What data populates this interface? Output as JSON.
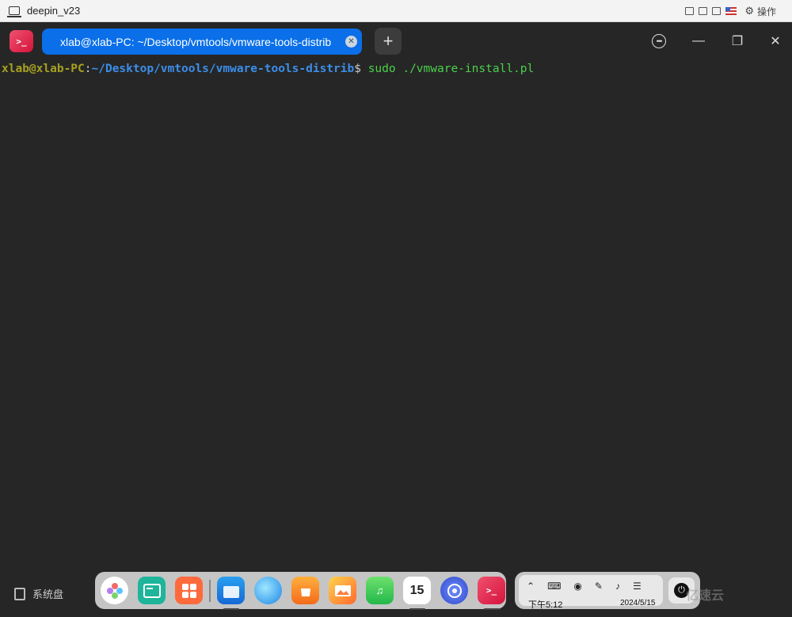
{
  "vm_window": {
    "title": "deepin_v23",
    "action_label": "操作"
  },
  "terminal_window": {
    "tab_title": "xlab@xlab-PC: ~/Desktop/vmtools/vmware-tools-distrib",
    "app_logo_text": ">_",
    "new_tab_symbol": "+",
    "menu_symbol": "•••",
    "minimize_symbol": "—",
    "maximize_symbol": "❐",
    "close_symbol": "✕",
    "tab_close_symbol": "✕"
  },
  "terminal": {
    "user_host": "xlab@xlab-PC",
    "colon": ":",
    "path": "~/Desktop/vmtools/vmware-tools-distrib",
    "dollar": "$",
    "command": " sudo ./vmware-install.pl"
  },
  "desktop": {
    "system_disk_label": "系统盘"
  },
  "dock": {
    "apps": [
      {
        "name": "launcher"
      },
      {
        "name": "multitasking"
      },
      {
        "name": "app-store"
      },
      {
        "name": "file-manager"
      },
      {
        "name": "browser"
      },
      {
        "name": "deepin-store"
      },
      {
        "name": "image-viewer"
      },
      {
        "name": "music"
      },
      {
        "name": "calendar",
        "label": "15"
      },
      {
        "name": "control-center"
      },
      {
        "name": "terminal",
        "label": ">_"
      }
    ]
  },
  "tray": {
    "time": "下午5:12",
    "date": "2024/5/15",
    "power_symbol": "⏻"
  },
  "watermark": "亿速云"
}
